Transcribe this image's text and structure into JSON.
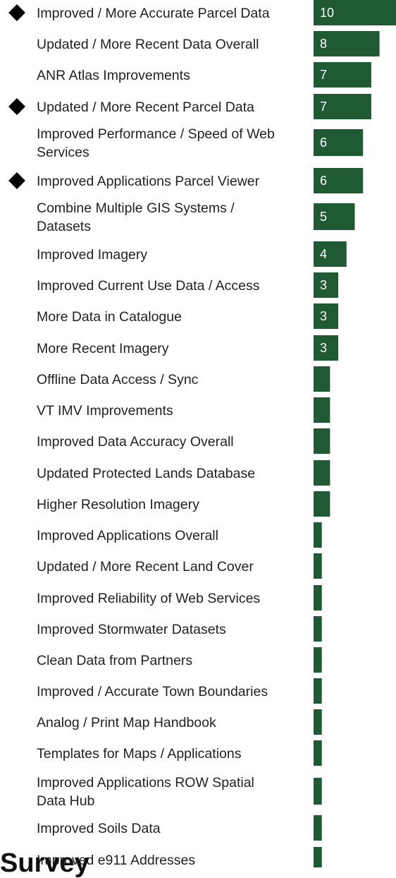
{
  "chart_data": {
    "type": "bar",
    "orientation": "horizontal",
    "bar_color": "#1f5a35",
    "value_label_color": "#ffffff",
    "marker_color": "#000000",
    "marker_shape": "diamond",
    "categories": [
      "Improved / More Accurate Parcel Data",
      "Updated / More Recent Data Overall",
      "ANR Atlas Improvements",
      "Updated / More Recent Parcel Data",
      "Improved Performance / Speed of Web Services",
      "Improved Applications Parcel Viewer",
      "Combine Multiple GIS Systems / Datasets",
      "Improved Imagery",
      "Improved Current Use Data / Access",
      "More Data in Catalogue",
      "More Recent Imagery",
      "Offline Data Access / Sync",
      "VT IMV Improvements",
      "Improved Data Accuracy Overall",
      "Updated Protected Lands Database",
      "Higher Resolution Imagery",
      "Improved Applications Overall",
      "Updated / More Recent Land Cover",
      "Improved Reliability of Web Services",
      "Improved Stormwater Datasets",
      "Clean Data from Partners",
      "Improved / Accurate Town Boundaries",
      "Analog / Print Map Handbook",
      "Templates for Maps / Applications",
      "Improved Applications ROW Spatial Data Hub",
      "Improved Soils Data",
      "Improved e911 Addresses"
    ],
    "values": [
      10,
      8,
      7,
      7,
      6,
      6,
      5,
      4,
      3,
      3,
      3,
      2,
      2,
      2,
      2,
      2,
      1,
      1,
      1,
      1,
      1,
      1,
      1,
      1,
      1,
      1,
      1
    ],
    "value_labels": [
      "10",
      "8",
      "7",
      "7",
      "6",
      "6",
      "5",
      "4",
      "3",
      "3",
      "3",
      "",
      "",
      "",
      "",
      "",
      "",
      "",
      "",
      "",
      "",
      "",
      "",
      "",
      "",
      "",
      ""
    ],
    "highlighted": [
      true,
      false,
      false,
      true,
      false,
      true,
      false,
      false,
      false,
      false,
      false,
      false,
      false,
      false,
      false,
      false,
      false,
      false,
      false,
      false,
      false,
      false,
      false,
      false,
      false,
      false,
      false
    ],
    "xlim": [
      0,
      10
    ],
    "title": "",
    "xlabel": "",
    "ylabel": ""
  },
  "bleed_text": "Survey"
}
